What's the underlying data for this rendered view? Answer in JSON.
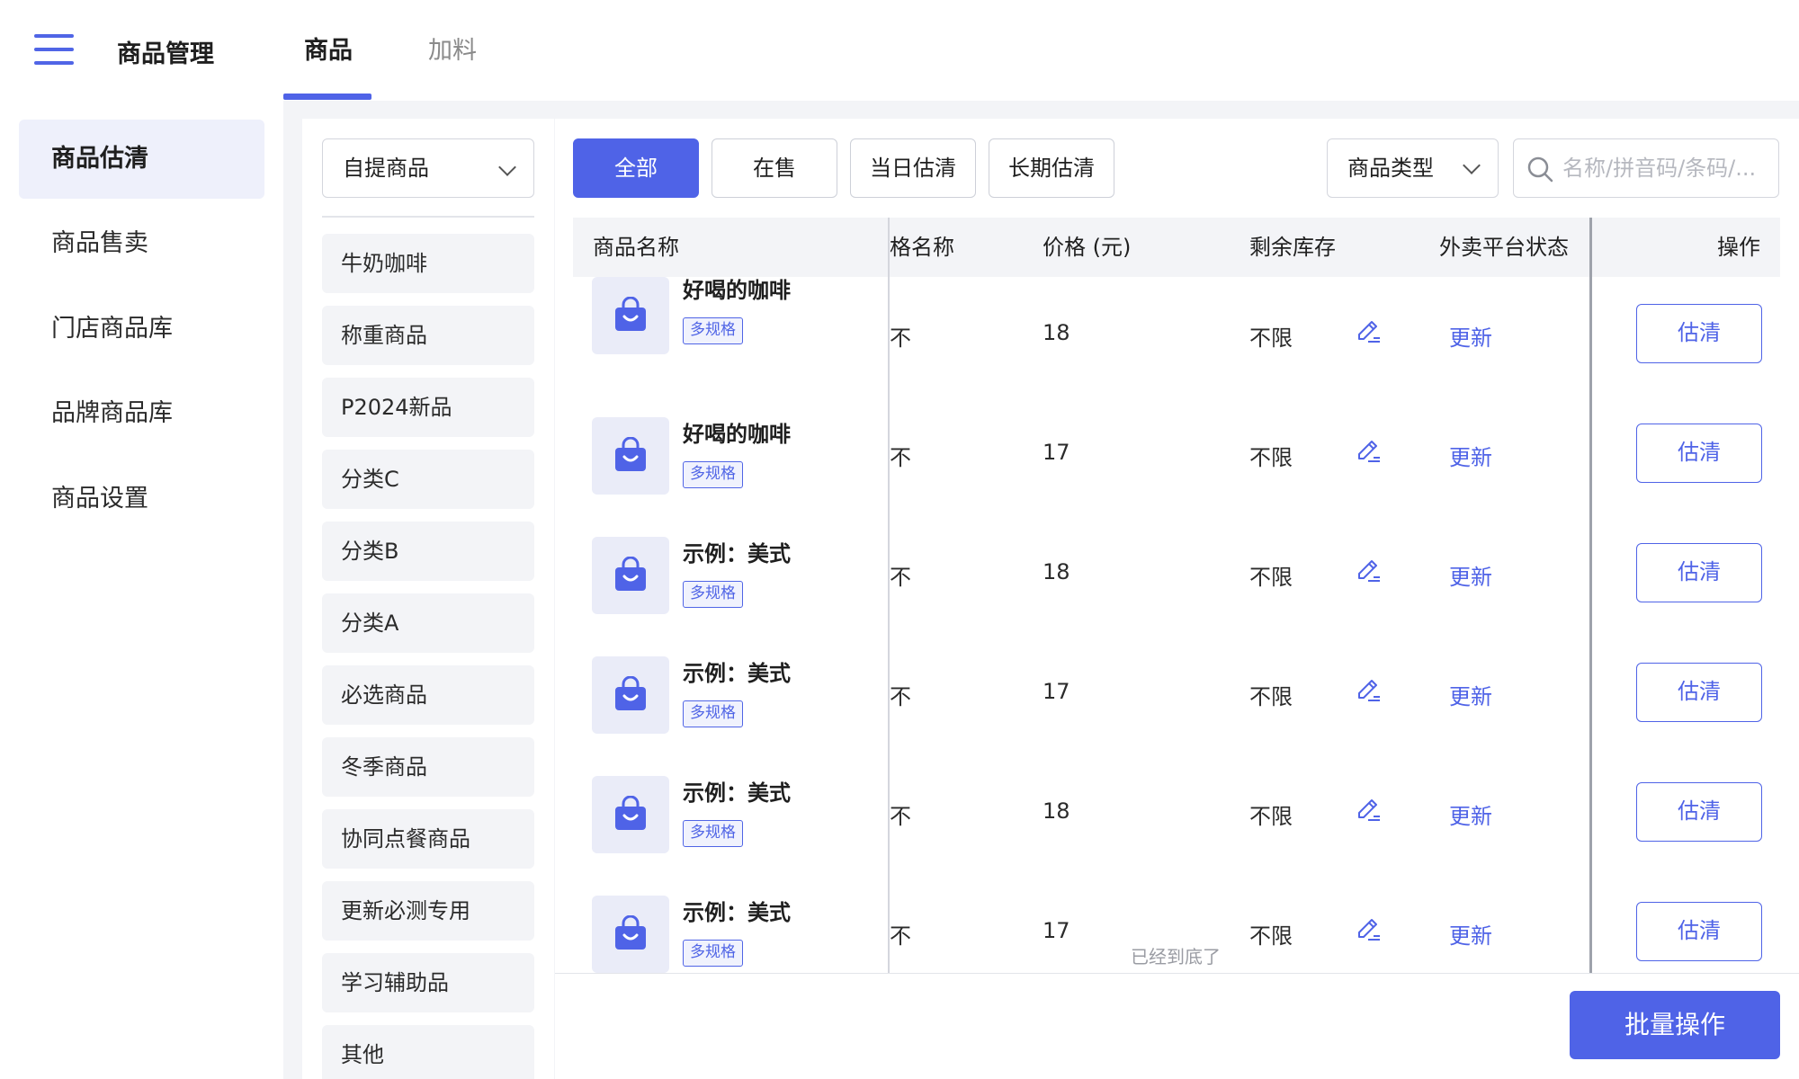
{
  "header": {
    "title": "商品管理",
    "tabs": [
      {
        "label": "商品",
        "active": true
      },
      {
        "label": "加料",
        "active": false
      }
    ]
  },
  "sidebar": {
    "items": [
      {
        "label": "商品估清",
        "active": true
      },
      {
        "label": "商品售卖",
        "active": false
      },
      {
        "label": "门店商品库",
        "active": false
      },
      {
        "label": "品牌商品库",
        "active": false
      },
      {
        "label": "商品设置",
        "active": false
      }
    ]
  },
  "categories": {
    "selected": "自提商品",
    "items": [
      "牛奶咖啡",
      "称重商品",
      "P2024新品",
      "分类C",
      "分类B",
      "分类A",
      "必选商品",
      "冬季商品",
      "协同点餐商品",
      "更新必测专用",
      "学习辅助品",
      "其他"
    ]
  },
  "filters": {
    "buttons": [
      {
        "label": "全部",
        "active": true
      },
      {
        "label": "在售",
        "active": false
      },
      {
        "label": "当日估清",
        "active": false
      },
      {
        "label": "长期估清",
        "active": false
      }
    ],
    "type_select": "商品类型",
    "search_placeholder": "名称/拼音码/条码/..."
  },
  "table": {
    "columns": {
      "name": "商品名称",
      "spec": "格名称",
      "price": "价格 (元)",
      "stock": "剩余库存",
      "platform": "外卖平台状态",
      "ops": "操作"
    },
    "rows": [
      {
        "name": "好喝的咖啡",
        "tag": "多规格",
        "spec": "不",
        "price": "18",
        "stock": "不限",
        "update": "更新",
        "action": "估清"
      },
      {
        "name": "好喝的咖啡",
        "tag": "多规格",
        "spec": "不",
        "price": "17",
        "stock": "不限",
        "update": "更新",
        "action": "估清"
      },
      {
        "name": "示例：美式",
        "tag": "多规格",
        "spec": "不",
        "price": "18",
        "stock": "不限",
        "update": "更新",
        "action": "估清"
      },
      {
        "name": "示例：美式",
        "tag": "多规格",
        "spec": "不",
        "price": "17",
        "stock": "不限",
        "update": "更新",
        "action": "估清"
      },
      {
        "name": "示例：美式",
        "tag": "多规格",
        "spec": "不",
        "price": "18",
        "stock": "不限",
        "update": "更新",
        "action": "估清"
      },
      {
        "name": "示例：美式",
        "tag": "多规格",
        "spec": "不",
        "price": "17",
        "stock": "不限",
        "update": "更新",
        "action": "估清"
      }
    ],
    "end_text": "已经到底了"
  },
  "footer": {
    "batch_label": "批量操作"
  },
  "colors": {
    "accent": "#4f63e7",
    "accent_light": "#eaecf8",
    "content_bg": "#f3f4f7"
  },
  "icons": {
    "menu": "menu-icon",
    "chevron": "chevron-down-icon",
    "search": "search-icon",
    "edit": "edit-icon",
    "product": "shopping-bag-icon"
  }
}
